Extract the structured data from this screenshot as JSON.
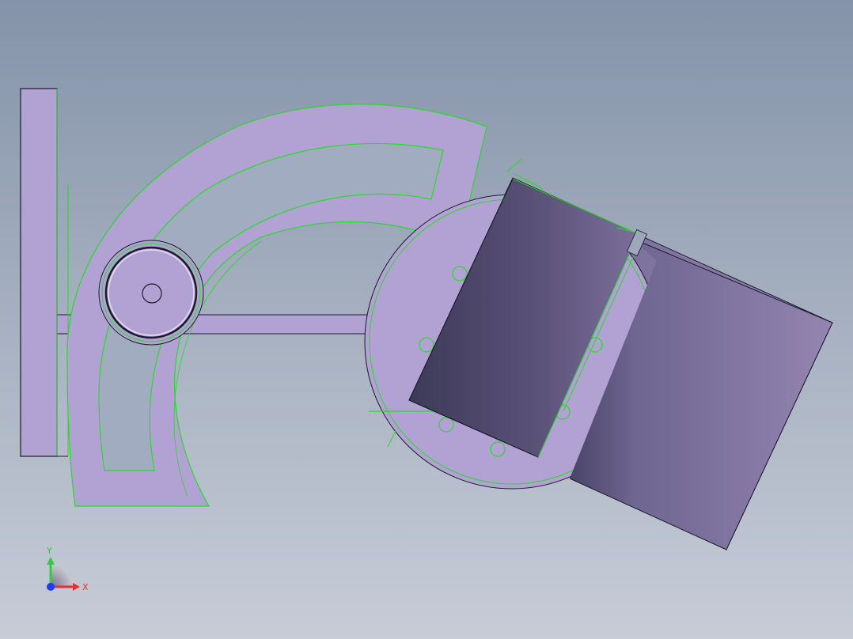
{
  "viewport": {
    "background_top": "#8493a9",
    "background_bottom": "#c7ccd7"
  },
  "colors": {
    "part_fill": "#b2a2d3",
    "selection_edge": "#22dd22",
    "outline": "#1b1b2a",
    "block_dark": "#3d3a58",
    "block_light": "#8a7dad",
    "axis_x": "#e8302a",
    "axis_y": "#2ecc40",
    "axis_z": "#1e3cff"
  },
  "parts": [
    {
      "name": "vertical-plate"
    },
    {
      "name": "arc-slot-bracket"
    },
    {
      "name": "pivot-disk"
    },
    {
      "name": "connecting-bar"
    },
    {
      "name": "rotary-base"
    },
    {
      "name": "rear-block"
    },
    {
      "name": "front-block"
    }
  ],
  "triad": {
    "x_label": "X",
    "y_label": "Y",
    "icon": "coordinate-triad-icon"
  }
}
